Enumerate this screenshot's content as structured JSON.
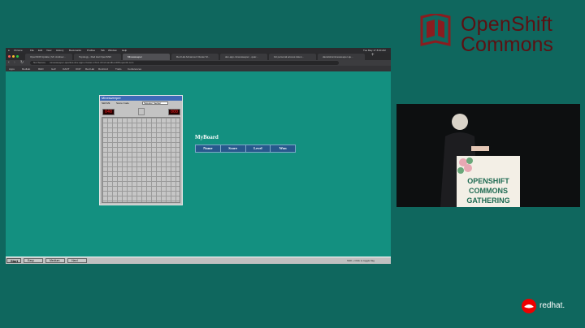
{
  "logo": {
    "line1": "OpenShift",
    "line2": "Commons"
  },
  "mac_menubar": [
    "Chrome",
    "File",
    "Edit",
    "View",
    "History",
    "Bookmarks",
    "Profiles",
    "Tab",
    "Window",
    "Help"
  ],
  "mac_clock": "Tue May 17  8:00 AM",
  "tabs": [
    "OpenShift Update | Mr. Andrew...",
    "Topology - Red Hat OpenShift",
    "Minesweeper",
    "Red Hat Advanced Cluster M...",
    "dev-app-minesweeper - quar...",
    "Git personal access token...",
    "danielstraminesweeper-qu..."
  ],
  "address": {
    "security": "Not Secure",
    "url": "minesweeper-quarkus-dev-apps.cluster-rcfm4.rcfm4.sandbox408.opentlc.com"
  },
  "bookmarks": [
    "Apps",
    "RedHat",
    "RHD",
    "Golf",
    "OAOT",
    "OCP",
    "Red Hat",
    "RunCmd",
    "Trello",
    "Conferences"
  ],
  "minesweeper": {
    "title": "Minesweeper",
    "menu": {
      "skill": "Skill Mk",
      "score_code": "Score Code",
      "name": "Sweeter Secker"
    },
    "mine_counter": "040",
    "timer": "000"
  },
  "board": {
    "title": "MyBoard",
    "columns": [
      "Name",
      "Score",
      "Level",
      "Won"
    ]
  },
  "taskbar": {
    "start": "Start",
    "items": [
      "Easy",
      "Medium",
      "Hard"
    ],
    "hint": "Shift + Click to toggle flag"
  },
  "podium": {
    "line1": "OPENSHIFT",
    "line2": "COMMONS",
    "line3": "GATHERING"
  },
  "brand": {
    "redhat": "redhat."
  },
  "colors": {
    "teal_bg": "#0f675e",
    "page_bg": "#139080",
    "logo_red": "#5b1113",
    "board_header": "#27588c"
  }
}
